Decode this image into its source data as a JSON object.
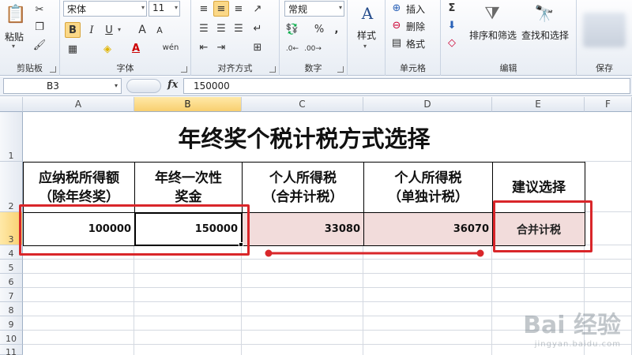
{
  "ribbon": {
    "clipboard": {
      "paste": "粘贴",
      "label": "剪贴板"
    },
    "font": {
      "name": "宋体",
      "size": "11",
      "label": "字体",
      "bold": "B",
      "italic": "I",
      "underline": "U",
      "grow": "A",
      "shrink": "A",
      "font_color": "A",
      "wen": "wén"
    },
    "alignment": {
      "label": "对齐方式"
    },
    "number": {
      "format": "常规",
      "percent": "%",
      "comma": ",",
      "label": "数字"
    },
    "styles": {
      "label": "样式"
    },
    "cells": {
      "insert": "插入",
      "delete": "删除",
      "format": "格式",
      "label": "单元格"
    },
    "editing": {
      "sort_filter": "排序和筛选",
      "find_select": "查找和选择",
      "label": "编辑",
      "sigma": "Σ"
    },
    "save": {
      "label": "保存"
    }
  },
  "formula_bar": {
    "name_box": "B3",
    "fx": "fx",
    "value": "150000"
  },
  "columns": [
    "A",
    "B",
    "C",
    "D",
    "E",
    "F"
  ],
  "rows": [
    "1",
    "2",
    "3",
    "4",
    "5",
    "6",
    "7",
    "8",
    "9",
    "10",
    "11"
  ],
  "table": {
    "title": "年终奖个税计税方式选择",
    "headers": {
      "a": "应纳税所得额\n（除年终奖）",
      "b": "年终一次性\n奖金",
      "c": "个人所得税\n（合并计税）",
      "d": "个人所得税\n（单独计税）",
      "e": "建议选择"
    },
    "values": {
      "a": "100000",
      "b": "150000",
      "c": "33080",
      "d": "36070",
      "e": "合并计税"
    }
  },
  "watermark": {
    "brand": "Bai 经验",
    "url": "jingyan.baidu.com"
  },
  "colors": {
    "accent_red": "#d9262a",
    "pink_fill": "#f2dcdb",
    "selected_header": "#f8cf6f"
  }
}
